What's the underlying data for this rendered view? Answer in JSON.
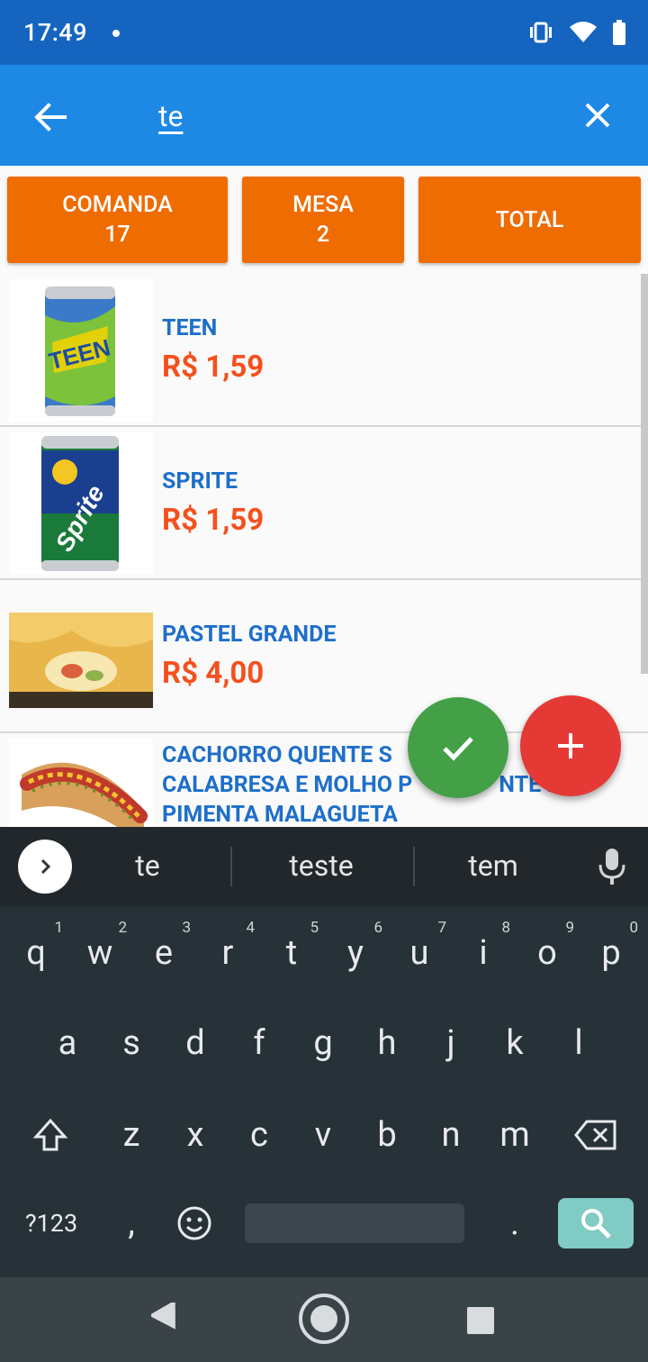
{
  "status_bar": {
    "time": "17:49"
  },
  "app_bar": {
    "search_query": "te"
  },
  "header_buttons": [
    {
      "line1": "COMANDA",
      "line2": "17"
    },
    {
      "line1": "MESA",
      "line2": "2"
    },
    {
      "line1": "TOTAL",
      "line2": ""
    }
  ],
  "products": [
    {
      "name": "TEEN",
      "price": "R$ 1,59"
    },
    {
      "name": "SPRITE",
      "price": "R$ 1,59"
    },
    {
      "name": "PASTEL GRANDE",
      "price": "R$ 4,00"
    },
    {
      "name": "CACHORRO QUENTE S... CALABRESA E MOLHO PICANTE DE PIMENTA MALAGUETA",
      "line1": "CACHORRO QUENTE S",
      "line1b": "A",
      "line2": "CALABRESA E MOLHO P",
      "line2b": "NTE DE",
      "line3": "PIMENTA MALAGUETA"
    }
  ],
  "keyboard": {
    "suggestions": [
      "te",
      "teste",
      "tem"
    ],
    "row1": [
      "q",
      "w",
      "e",
      "r",
      "t",
      "y",
      "u",
      "i",
      "o",
      "p"
    ],
    "row1_hints": [
      "1",
      "2",
      "3",
      "4",
      "5",
      "6",
      "7",
      "8",
      "9",
      "0"
    ],
    "row2": [
      "a",
      "s",
      "d",
      "f",
      "g",
      "h",
      "j",
      "k",
      "l"
    ],
    "row3": [
      "z",
      "x",
      "c",
      "v",
      "b",
      "n",
      "m"
    ],
    "symbols_key": "?123",
    "comma_key": ",",
    "period_key": "."
  },
  "colors": {
    "status_bar": "#1565c0",
    "app_bar": "#1e88e5",
    "orange_button": "#ef6c00",
    "product_name": "#1e6fc9",
    "price": "#f4511e",
    "fab_check": "#43a047",
    "fab_add": "#e53935"
  }
}
